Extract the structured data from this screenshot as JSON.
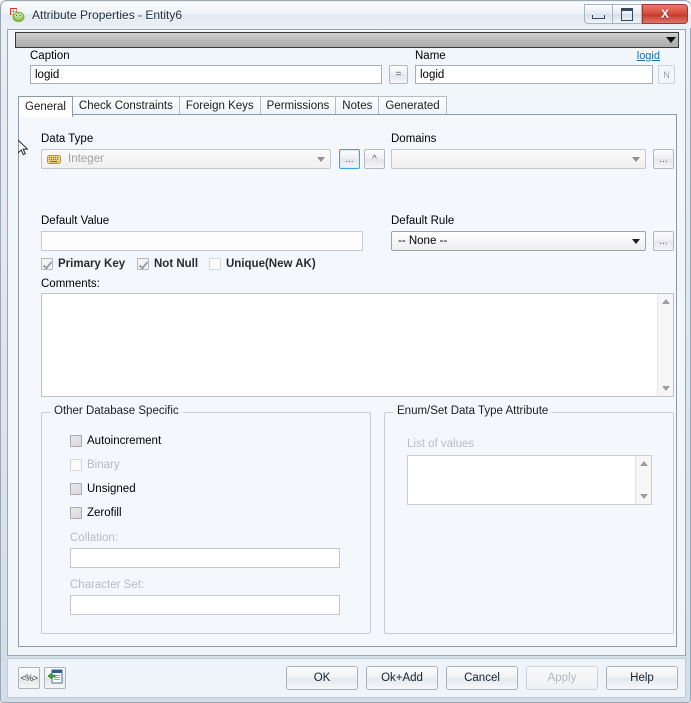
{
  "window": {
    "title": "Attribute Properties - Entity6",
    "icon": "app-table-icon",
    "minimize_label": "Minimize",
    "maximize_label": "Maximize",
    "close_label": "X"
  },
  "toolstrip": {
    "dropdown_icon": "chevron-down-icon"
  },
  "header": {
    "caption_label": "Caption",
    "caption_value": "logid",
    "equals_button": "=",
    "name_label": "Name",
    "name_value": "logid",
    "name_link": "logid",
    "name_side_button": "N"
  },
  "tabs": [
    {
      "label": "General",
      "active": true
    },
    {
      "label": "Check Constraints",
      "active": false
    },
    {
      "label": "Foreign Keys",
      "active": false
    },
    {
      "label": "Permissions",
      "active": false
    },
    {
      "label": "Notes",
      "active": false
    },
    {
      "label": "Generated",
      "active": false
    }
  ],
  "general": {
    "data_type_label": "Data Type",
    "data_type_value": "Integer",
    "data_type_icon": "datatype-integer-icon",
    "data_type_browse_button": "...",
    "data_type_up_button": "^",
    "domains_label": "Domains",
    "domains_value": "",
    "domains_browse_button": "...",
    "default_value_label": "Default Value",
    "default_value": "",
    "default_rule_label": "Default Rule",
    "default_rule_value": "-- None --",
    "default_rule_browse_button": "...",
    "checks": [
      {
        "label": "Primary Key",
        "checked": true,
        "enabled": false
      },
      {
        "label": "Not Null",
        "checked": true,
        "enabled": false
      },
      {
        "label": "Unique(New AK)",
        "checked": false,
        "enabled": false
      }
    ],
    "comments_label": "Comments:",
    "comments_value": ""
  },
  "other_db": {
    "group_title": "Other Database Specific",
    "checks": [
      {
        "label": "Autoincrement",
        "checked": false,
        "enabled": true
      },
      {
        "label": "Binary",
        "checked": false,
        "enabled": false
      },
      {
        "label": "Unsigned",
        "checked": false,
        "enabled": true
      },
      {
        "label": "Zerofill",
        "checked": false,
        "enabled": true
      }
    ],
    "collation_label": "Collation:",
    "collation_value": "",
    "charset_label": "Character Set:",
    "charset_value": ""
  },
  "enumset": {
    "group_title": "Enum/Set Data Type Attribute",
    "list_label": "List of values",
    "list_value": ""
  },
  "bottom": {
    "tool_code_button": "<%>",
    "tool_paste_button": "paste-script-icon",
    "buttons": [
      {
        "label": "OK",
        "enabled": true
      },
      {
        "label": "Ok+Add",
        "enabled": true
      },
      {
        "label": "Cancel",
        "enabled": true
      },
      {
        "label": "Apply",
        "enabled": false
      },
      {
        "label": "Help",
        "enabled": true
      }
    ]
  },
  "colors": {
    "close_red": "#d84a3c",
    "link_blue": "#1a6fb5",
    "client_bg": "#f1f6fb",
    "tabpage_bg": "#f4f8fc"
  }
}
